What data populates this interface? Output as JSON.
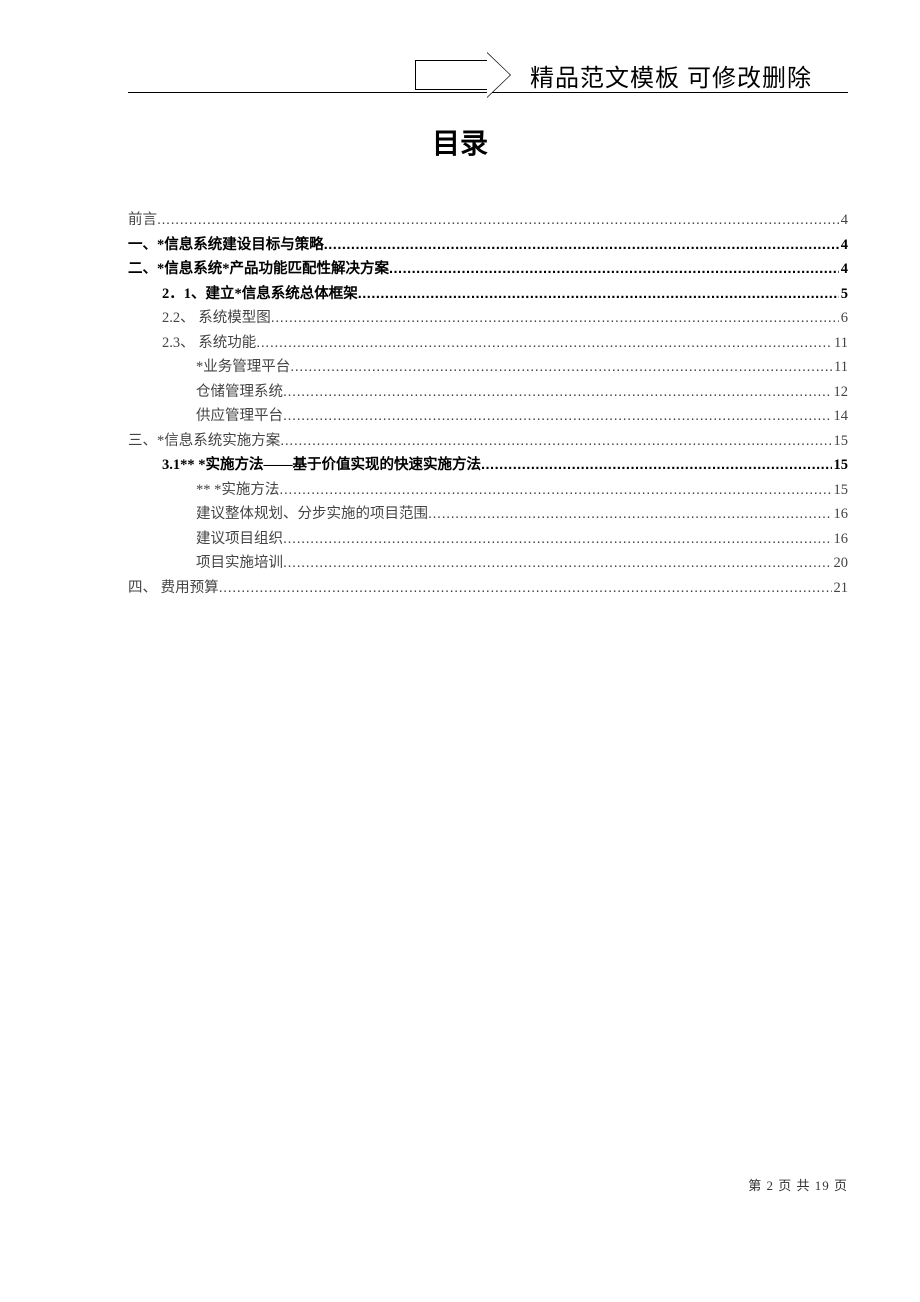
{
  "header": {
    "banner_text": "精品范文模板  可修改删除"
  },
  "title": "目录",
  "toc": [
    {
      "level": 0,
      "text": "前言",
      "page": "4",
      "bold": false
    },
    {
      "level": 0,
      "text": "一、*信息系统建设目标与策略",
      "page": "4",
      "bold": true
    },
    {
      "level": 0,
      "text": "二、*信息系统*产品功能匹配性解决方案",
      "page": "4",
      "bold": true
    },
    {
      "level": 1,
      "text": "2．1、建立*信息系统总体框架",
      "page": "5",
      "bold": true
    },
    {
      "level": 1,
      "text": "2.2、 系统模型图",
      "page": "6",
      "bold": false
    },
    {
      "level": 1,
      "text": "2.3、 系统功能",
      "page": "11",
      "bold": false
    },
    {
      "level": 2,
      "text": "*业务管理平台",
      "page": "11",
      "bold": false
    },
    {
      "level": 2,
      "text": "仓储管理系统",
      "page": "12",
      "bold": false
    },
    {
      "level": 2,
      "text": "供应管理平台",
      "page": "14",
      "bold": false
    },
    {
      "level": 0,
      "text": "三、*信息系统实施方案",
      "page": "15",
      "bold": false
    },
    {
      "level": 1,
      "text": "3.1** *实施方法——基于价值实现的快速实施方法",
      "page": "15",
      "bold": true
    },
    {
      "level": 2,
      "text": "** *实施方法",
      "page": "15",
      "bold": false
    },
    {
      "level": 2,
      "text": "建议整体规划、分步实施的项目范围",
      "page": "16",
      "bold": false
    },
    {
      "level": 2,
      "text": "建议项目组织",
      "page": "16",
      "bold": false
    },
    {
      "level": 2,
      "text": "项目实施培训",
      "page": "20",
      "bold": false
    },
    {
      "level": 0,
      "text": "四、 费用预算",
      "page": "21",
      "bold": false
    }
  ],
  "footer": {
    "prefix": "第 ",
    "current": "2",
    "mid": " 页 共 ",
    "total": "19",
    "suffix": " 页"
  }
}
